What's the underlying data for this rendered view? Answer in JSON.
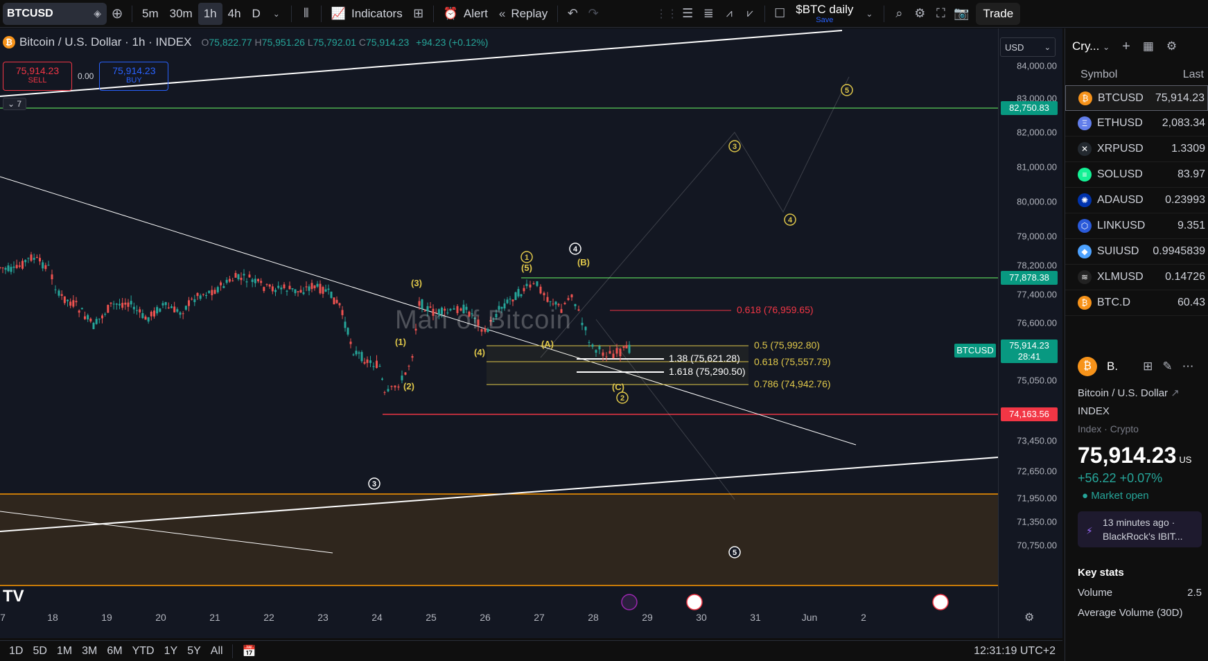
{
  "toolbar": {
    "symbol": "BTCUSD",
    "intervals": [
      "5m",
      "30m",
      "1h",
      "4h",
      "D"
    ],
    "active_interval": "1h",
    "indicators_label": "Indicators",
    "alert_label": "Alert",
    "replay_label": "Replay",
    "layout_name": "$BTC daily",
    "save_label": "Save",
    "trade_label": "Trade"
  },
  "legend": {
    "title": "Bitcoin / U.S. Dollar · 1h · INDEX",
    "open": "75,822.77",
    "high": "75,951.26",
    "low": "75,792.01",
    "close": "75,914.23",
    "change": "+94.23 (+0.12%)"
  },
  "trade": {
    "sell_price": "75,914.23",
    "sell_label": "SELL",
    "spread": "0.00",
    "buy_price": "75,914.23",
    "buy_label": "BUY"
  },
  "indicator_collapse": "7",
  "watermark": "Man of Bitcoin",
  "currency": "USD",
  "price_axis": {
    "labels": [
      "84,000.00",
      "83,000.00",
      "82,000.00",
      "81,000.00",
      "80,000.00",
      "79,000.00",
      "78,200.00",
      "77,400.00",
      "76,600.00",
      "75,050.00",
      "73,450.00",
      "72,650.00",
      "71,950.00",
      "71,350.00",
      "70,750.00"
    ],
    "tags": [
      {
        "text": "82,750.83",
        "color": "#089981"
      },
      {
        "text": "77,878.38",
        "color": "#089981"
      },
      {
        "text": "75,914.23",
        "color": "#089981",
        "sub": "28:41"
      },
      {
        "text": "74,163.56",
        "color": "#f23645"
      }
    ],
    "symbol_tag": "BTCUSD"
  },
  "time_axis": [
    "7",
    "18",
    "19",
    "20",
    "21",
    "22",
    "23",
    "24",
    "25",
    "26",
    "27",
    "28",
    "29",
    "30",
    "31",
    "Jun",
    "2"
  ],
  "fib_labels": [
    {
      "text": "0.618 (76,959.65)",
      "color": "#f23645"
    },
    {
      "text": "0.5 (75,992.80)",
      "color": "#e0c84a"
    },
    {
      "text": "1.38 (75,621.28)",
      "color": "#ffffff"
    },
    {
      "text": "0.618 (75,557.79)",
      "color": "#e0c84a"
    },
    {
      "text": "1.618 (75,290.50)",
      "color": "#ffffff"
    },
    {
      "text": "0.786 (74,942.76)",
      "color": "#e0c84a"
    }
  ],
  "wave_labels": [
    "1",
    "5",
    "(5)",
    "3",
    "4",
    "(B)",
    "(3)",
    "(1)",
    "(2)",
    "(4)",
    "(A)",
    "(C)",
    "2",
    "3",
    "4",
    "5"
  ],
  "bottom": {
    "ranges": [
      "1D",
      "5D",
      "1M",
      "3M",
      "6M",
      "YTD",
      "1Y",
      "5Y",
      "All"
    ],
    "clock": "12:31:19 UTC+2"
  },
  "watchlist": {
    "name": "Cry...",
    "col_symbol": "Symbol",
    "col_last": "Last",
    "rows": [
      {
        "symbol": "BTCUSD",
        "last": "75,914.23",
        "icon": "₿",
        "color": "#f7931a"
      },
      {
        "symbol": "ETHUSD",
        "last": "2,083.34",
        "icon": "Ξ",
        "color": "#627eea"
      },
      {
        "symbol": "XRPUSD",
        "last": "1.3309",
        "icon": "✕",
        "color": "#23292f"
      },
      {
        "symbol": "SOLUSD",
        "last": "83.97",
        "icon": "≡",
        "color": "#14f195"
      },
      {
        "symbol": "ADAUSD",
        "last": "0.23993",
        "icon": "✺",
        "color": "#0033ad"
      },
      {
        "symbol": "LINKUSD",
        "last": "9.351",
        "icon": "⬡",
        "color": "#2a5ada"
      },
      {
        "symbol": "SUIUSD",
        "last": "0.9945839",
        "icon": "◆",
        "color": "#4da2ff"
      },
      {
        "symbol": "XLMUSD",
        "last": "0.14726",
        "icon": "≋",
        "color": "#222222"
      },
      {
        "symbol": "BTC.D",
        "last": "60.43",
        "icon": "₿",
        "color": "#f7931a"
      }
    ]
  },
  "details": {
    "short": "B.",
    "name": "Bitcoin / U.S. Dollar",
    "exchange": "INDEX",
    "category": "Index · Crypto",
    "price": "75,914.23",
    "currency": "US",
    "change": "+56.22  +0.07%",
    "status": "● Market open",
    "news_time": "13 minutes ago ·",
    "news_title": "BlackRock's IBIT...",
    "stats_title": "Key stats",
    "stat_volume": "Volume",
    "stat_volume_val": "2.5",
    "stat_avgvol": "Average Volume (30D)"
  }
}
